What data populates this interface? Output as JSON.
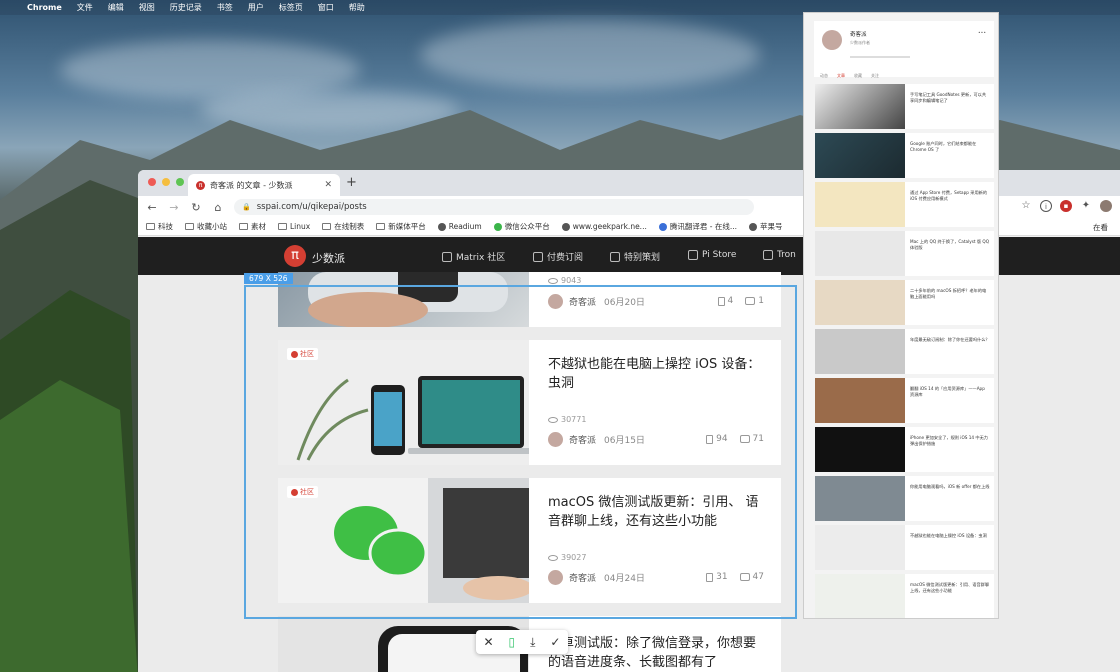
{
  "menubar": {
    "app": "Chrome",
    "items": [
      "文件",
      "编辑",
      "视图",
      "历史记录",
      "书签",
      "用户",
      "标签页",
      "窗口",
      "帮助"
    ]
  },
  "browser": {
    "tab_title": "奇客派 的文章 - 少数派",
    "url": "sspai.com/u/qikepai/posts",
    "bookmarks": [
      "科技",
      "收藏小站",
      "素材",
      "Linux",
      "在线制表",
      "新媒体平台",
      "Readium",
      "微信公众平台",
      "www.geekpark.ne...",
      "腾讯翻译君 - 在线...",
      "苹果号"
    ],
    "bookmark_partial_right": "在看"
  },
  "site": {
    "logo_char": "π",
    "name": "少数派",
    "nav": [
      "Matrix 社区",
      "付费订阅",
      "特别策划",
      "Pi Store",
      "Tron"
    ]
  },
  "capture": {
    "dimensions": "679 X 526"
  },
  "articles": [
    {
      "views": "9043",
      "author": "奇客派",
      "date": "06月20日",
      "likes": "4",
      "comments": "1"
    },
    {
      "tag": "社区",
      "title": "不越狱也能在电脑上操控 iOS 设备：虫洞",
      "views": "30771",
      "author": "奇客派",
      "date": "06月15日",
      "likes": "94",
      "comments": "71"
    },
    {
      "tag": "社区",
      "title": "macOS 微信测试版更新：引用、 语音群聊上线，还有这些小功能",
      "views": "39027",
      "author": "奇客派",
      "date": "04月24日",
      "likes": "31",
      "comments": "47"
    },
    {
      "title": "安卓测试版：除了微信登录，你想要的语音进度条、长截图都有了"
    }
  ],
  "preview": {
    "profile_name": "奇客派",
    "profile_badge": "少数派作者",
    "tabs": [
      "动态",
      "文章",
      "收藏",
      "关注"
    ],
    "cards": [
      "手写笔记工具 GoodNotes 更新，可以共享同步和编辑笔记了",
      "Google 账户同时，它们结束都能在 Chrome OS 了",
      "通过 App Store 付费，Setapp 采用新的 iOS 付费应用新模式",
      "Mac 上的 QQ 终于换了，Catalyst 版 QQ 体验版",
      "二十多年前的 macOS 拆招呼？老年的电脑上面能用吗",
      "年度最无敌订阅制：除了你在还要吗什么？",
      "翻翻 iOS 14 的「应用资源库」——App 资源库",
      "iPhone 更加安全了，规则 iOS 14 中无力弹出保护措施",
      "你能用电脑观看吗，iOS 新 offer 都在上线",
      "不越狱也能在电脑上操控 iOS 设备：虫洞",
      "macOS 微信测试版更新：引用、语音群聊上线，还有这些小功能"
    ]
  }
}
